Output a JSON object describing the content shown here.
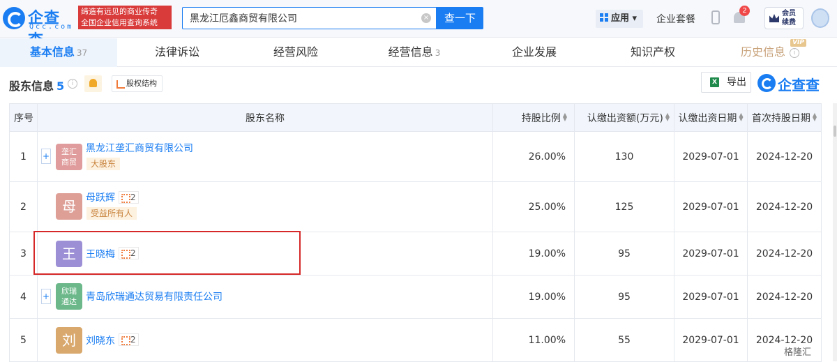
{
  "header": {
    "logo_text": "企查查",
    "logo_sub": "Qcc.com",
    "slogan_line1": "缔造有远见的商业传奇",
    "slogan_line2": "全国企业信用查询系统",
    "search_value": "黑龙江厄鑫商贸有限公司",
    "search_button": "查一下",
    "app_label": "应用",
    "enterprise_label": "企业套餐",
    "notification_count": "2",
    "member_line1": "会员",
    "member_line2": "续费"
  },
  "tabs": [
    {
      "label": "基本信息",
      "count": "37"
    },
    {
      "label": "法律诉讼",
      "count": ""
    },
    {
      "label": "经营风险",
      "count": ""
    },
    {
      "label": "经营信息",
      "count": "3"
    },
    {
      "label": "企业发展",
      "count": ""
    },
    {
      "label": "知识产权",
      "count": ""
    },
    {
      "label": "历史信息",
      "count": "",
      "badge": "VIP"
    }
  ],
  "section": {
    "title": "股东信息",
    "count": "5",
    "equity_button": "股权结构",
    "export_button": "导出",
    "brand": "企查查"
  },
  "table": {
    "headers": [
      "序号",
      "股东名称",
      "持股比例",
      "认缴出资额(万元)",
      "认缴出资日期",
      "首次持股日期"
    ],
    "rows": [
      {
        "idx": "1",
        "logo": "垄汇商贸",
        "logo_line1": "垄汇",
        "logo_line2": "商贸",
        "logo_color": "#e09c9c",
        "type": "company",
        "name": "黑龙江垄汇商贸有限公司",
        "tag": "大股东",
        "relations": "",
        "ratio": "26.00%",
        "capital": "130",
        "date": "2029-07-01",
        "first": "2024-12-20"
      },
      {
        "idx": "2",
        "logo": "母",
        "logo_color": "#de9f97",
        "type": "person",
        "name": "母跃辉",
        "tag": "受益所有人",
        "relations": "2",
        "ratio": "25.00%",
        "capital": "125",
        "date": "2029-07-01",
        "first": "2024-12-20"
      },
      {
        "idx": "3",
        "logo": "王",
        "logo_color": "#9d8fd6",
        "type": "person",
        "name": "王晓梅",
        "tag": "",
        "relations": "2",
        "ratio": "19.00%",
        "capital": "95",
        "date": "2029-07-01",
        "first": "2024-12-20"
      },
      {
        "idx": "4",
        "logo": "欣瑞通达",
        "logo_line1": "欣瑞",
        "logo_line2": "通达",
        "logo_color": "#6cb88a",
        "type": "company",
        "name": "青岛欣瑞通达贸易有限责任公司",
        "tag": "",
        "relations": "",
        "ratio": "19.00%",
        "capital": "95",
        "date": "2029-07-01",
        "first": "2024-12-20"
      },
      {
        "idx": "5",
        "logo": "刘",
        "logo_color": "#d9a86c",
        "type": "person",
        "name": "刘晓东",
        "tag": "",
        "relations": "2",
        "ratio": "11.00%",
        "capital": "55",
        "date": "2029-07-01",
        "first": "2024-12-20"
      }
    ]
  },
  "footer": {
    "source": "格隆汇"
  },
  "colors": {
    "brand": "#1a7df2",
    "highlight": "#d62828",
    "header_bg": "#f2f6fc"
  }
}
